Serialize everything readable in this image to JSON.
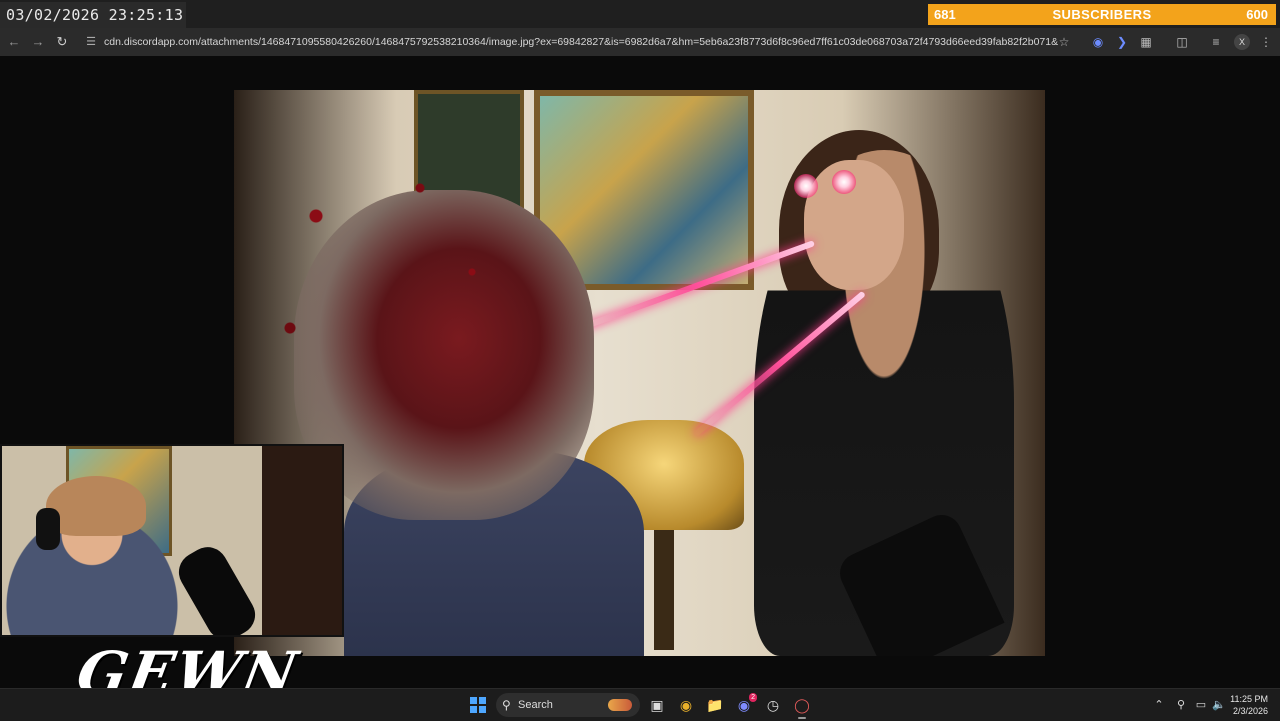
{
  "overlay": {
    "clock": "03/02/2026 23:25:13",
    "subscribers": {
      "current": "681",
      "label": "SUBSCRIBERS",
      "goal": "600"
    },
    "logo_text": "GEWN"
  },
  "browser": {
    "url": "cdn.discordapp.com/attachments/1468471095580426260/1468475792538210364/image.jpg?ex=69842827&is=6982d6a7&hm=5eb6a23f8773d6f8c96ed7ff61c03de068703a72f4793d66eed39fab82f2b071&",
    "icons": {
      "back": "back-arrow-icon",
      "forward": "forward-arrow-icon",
      "reload": "reload-icon",
      "site_info": "site-info-icon",
      "bookmark": "star-icon",
      "extensions": "puzzle-icon",
      "menu": "kebab-menu-icon"
    },
    "profile_initial": "X"
  },
  "taskbar": {
    "search_label": "Search",
    "discord_badge": "2",
    "time": "11:25 PM",
    "date": "2/3/2026"
  }
}
